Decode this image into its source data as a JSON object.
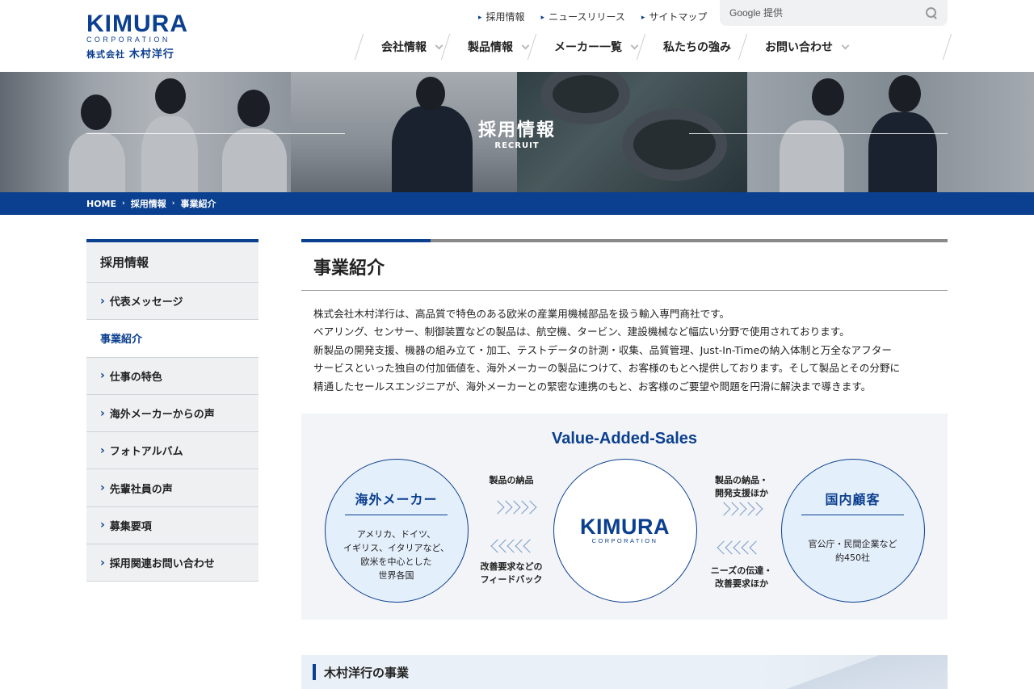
{
  "logo": {
    "main": "KIMURA",
    "sub": "CORPORATION",
    "jp_prefix": "株式会社",
    "jp_name": "木村洋行"
  },
  "util_links": [
    "採用情報",
    "ニュースリリース",
    "サイトマップ"
  ],
  "search": {
    "placeholder": "Google 提供"
  },
  "gnav": [
    {
      "label": "会社情報",
      "has_dropdown": true
    },
    {
      "label": "製品情報",
      "has_dropdown": true
    },
    {
      "label": "メーカー一覧",
      "has_dropdown": true
    },
    {
      "label": "私たちの強み",
      "has_dropdown": false
    },
    {
      "label": "お問い合わせ",
      "has_dropdown": true
    }
  ],
  "hero": {
    "title": "採用情報",
    "subtitle": "RECRUIT"
  },
  "breadcrumb": [
    "HOME",
    "採用情報",
    "事業紹介"
  ],
  "sidebar": {
    "title": "採用情報",
    "items": [
      "代表メッセージ",
      "事業紹介",
      "仕事の特色",
      "海外メーカーからの声",
      "フォトアルバム",
      "先輩社員の声",
      "募集要項",
      "採用関連お問い合わせ"
    ],
    "active_index": 1
  },
  "main": {
    "heading": "事業紹介",
    "lead": [
      "株式会社木村洋行は、高品質で特色のある欧米の産業用機械部品を扱う輸入専門商社です。",
      "ベアリング、センサー、制御装置などの製品は、航空機、タービン、建設機械など幅広い分野で使用されております。",
      "新製品の開発支援、機器の組み立て・加工、テストデータの計測・収集、品質管理、Just-In-Timeの納入体制と万全なアフター",
      "サービスといった独自の付加価値を、海外メーカーの製品につけて、お客様のもとへ提供しております。そして製品とその分野に",
      "精通したセールスエンジニアが、海外メーカーとの緊密な連携のもと、お客様のご要望や問題を円滑に解決まで導きます。"
    ]
  },
  "diagram": {
    "title": "Value-Added-Sales",
    "left": {
      "head": "海外メーカー",
      "body": "アメリカ、ドイツ、\nイギリス、イタリアなど、\n欧米を中心とした\n世界各国"
    },
    "center": {
      "main": "KIMURA",
      "sub": "CORPORATION"
    },
    "right": {
      "head": "国内顧客",
      "body": "官公庁・民間企業など\n約450社"
    },
    "flow_lr_top": "製品の納品",
    "flow_lr_bottom": "改善要求などの\nフィードバック",
    "flow_rl_top": "製品の納品・\n開発支援ほか",
    "flow_rl_bottom": "ニーズの伝達・\n改善要求ほか"
  },
  "section2": {
    "title": "木村洋行の事業"
  },
  "colors": {
    "brand": "#0b3f8f",
    "sidebar_bg": "#eef0f2",
    "diagram_bg": "#f2f4f7"
  }
}
